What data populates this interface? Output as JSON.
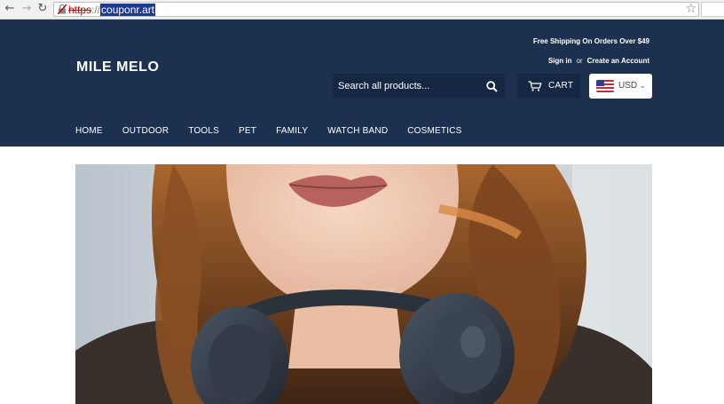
{
  "browser": {
    "url_scheme": "https",
    "url_separator": "://",
    "url_host": "couponr.art"
  },
  "site": {
    "logo": "MILE MELO",
    "shipping_notice": "Free Shipping On Orders Over $49",
    "sign_in": "Sign in",
    "or": "or",
    "create_account": "Create an Account",
    "search_placeholder": "Search all products...",
    "cart_label": "CART",
    "currency": "USD"
  },
  "menu": {
    "items": [
      "HOME",
      "OUTDOOR",
      "TOOLS",
      "PET",
      "FAMILY",
      "WATCH BAND",
      "COSMETICS"
    ]
  },
  "colors": {
    "header_bg": "#1c3150",
    "button_bg": "#152742",
    "url_scheme_error": "#cc0000"
  },
  "icons": {
    "search": "search-icon",
    "cart": "cart-icon",
    "flag": "us-flag-icon"
  }
}
